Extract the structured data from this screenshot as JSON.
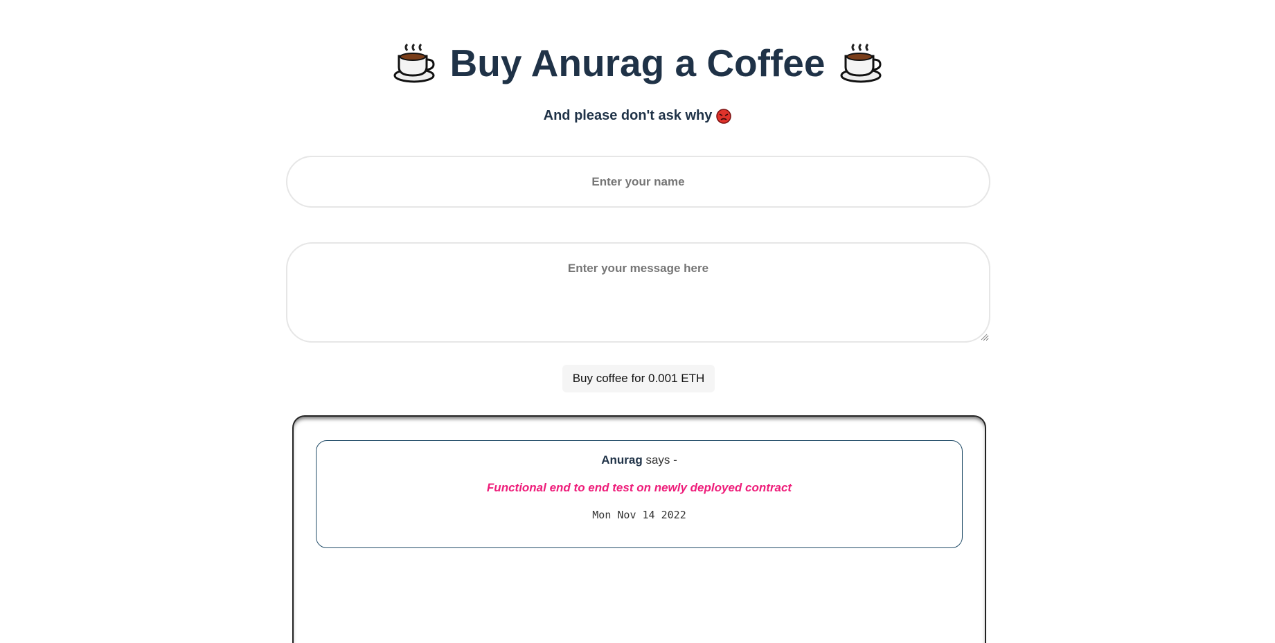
{
  "header": {
    "title": "Buy Anurag a Coffee",
    "title_icon": "hot-beverage-icon",
    "subtitle": "And please don't ask why",
    "subtitle_icon": "angry-face-icon"
  },
  "form": {
    "name_placeholder": "Enter your name",
    "name_value": "",
    "message_placeholder": "Enter your message here",
    "message_value": "",
    "buy_button_label": "Buy coffee for 0.001 ETH"
  },
  "memos": [
    {
      "author": "Anurag",
      "says": "says -",
      "message": "Functional end to end test on newly deployed contract",
      "date": "Mon Nov 14 2022"
    }
  ],
  "colors": {
    "heading": "#1f3247",
    "message_accent": "#ee1d7a",
    "card_border": "#1f4a66"
  }
}
